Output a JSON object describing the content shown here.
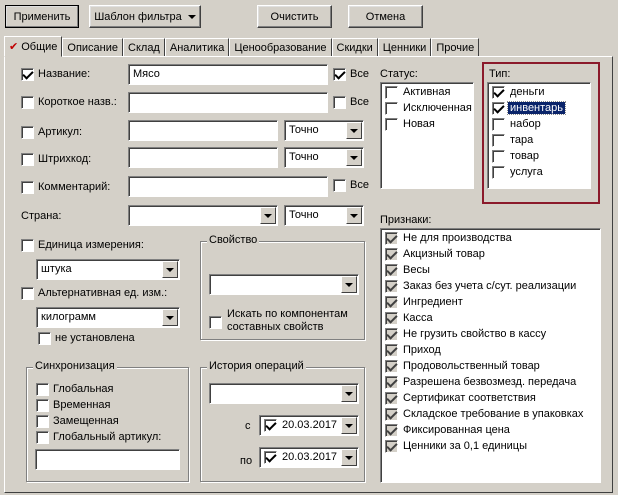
{
  "toolbar": {
    "apply": "Применить",
    "filter_template": "Шаблон фильтра",
    "clear": "Очистить",
    "cancel": "Отмена"
  },
  "tabs": [
    {
      "label": "Общие",
      "active": true
    },
    {
      "label": "Описание"
    },
    {
      "label": "Склад"
    },
    {
      "label": "Аналитика"
    },
    {
      "label": "Ценообразование"
    },
    {
      "label": "Скидки"
    },
    {
      "label": "Ценники"
    },
    {
      "label": "Прочие"
    }
  ],
  "fields": {
    "name": {
      "label": "Название:",
      "checked": true,
      "value": "Мясо",
      "all_label": "Все",
      "all_checked": true
    },
    "short_name": {
      "label": "Короткое назв.:",
      "checked": false,
      "value": "",
      "all_label": "Все",
      "all_checked": false
    },
    "article": {
      "label": "Артикул:",
      "checked": false,
      "value": "",
      "match": "Точно"
    },
    "barcode": {
      "label": "Штрихкод:",
      "checked": false,
      "value": "",
      "match": "Точно"
    },
    "comment": {
      "label": "Комментарий:",
      "checked": false,
      "value": "",
      "all_label": "Все",
      "all_checked": false
    },
    "country": {
      "label": "Страна:",
      "value": "",
      "match": "Точно"
    }
  },
  "unit": {
    "label": "Единица измерения:",
    "checked": false,
    "value": "штука",
    "alt_label": "Альтернативная ед. изм.:",
    "alt_checked": false,
    "alt_value": "килограмм",
    "not_set_label": "не установлена",
    "not_set_checked": false
  },
  "property": {
    "title": "Свойство",
    "value": "",
    "search_components": "Искать по компонентам составных свойств",
    "search_components_line1": "Искать по компонентам",
    "search_components_line2": "составных свойств"
  },
  "sync": {
    "title": "Синхронизация",
    "items": [
      {
        "label": "Глобальная",
        "checked": false
      },
      {
        "label": "Временная",
        "checked": false
      },
      {
        "label": "Замещенная",
        "checked": false
      },
      {
        "label": "Глобальный артикул:",
        "checked": false
      }
    ],
    "global_article_value": ""
  },
  "history": {
    "title": "История операций",
    "value": "",
    "from_label": "с",
    "from_date": "20.03.2017",
    "to_label": "по",
    "to_date": "20.03.2017"
  },
  "status": {
    "label": "Статус:",
    "items": [
      {
        "label": "Активная",
        "checked": false
      },
      {
        "label": "Исключенная",
        "checked": false
      },
      {
        "label": "Новая",
        "checked": false
      }
    ]
  },
  "type": {
    "label": "Тип:",
    "items": [
      {
        "label": "деньги",
        "checked": true
      },
      {
        "label": "инвентарь",
        "checked": true,
        "selected": true
      },
      {
        "label": "набор",
        "checked": false
      },
      {
        "label": "тара",
        "checked": false
      },
      {
        "label": "товар",
        "checked": false
      },
      {
        "label": "услуга",
        "checked": false
      }
    ],
    "highlight_color": "#8b1a2b"
  },
  "features": {
    "label": "Признаки:",
    "items": [
      {
        "label": "Не для производства",
        "checked": true
      },
      {
        "label": "Акцизный товар",
        "checked": true
      },
      {
        "label": "Весы",
        "checked": true
      },
      {
        "label": "Заказ без учета с/сут. реализации",
        "checked": true
      },
      {
        "label": "Ингредиент",
        "checked": true
      },
      {
        "label": "Касса",
        "checked": true
      },
      {
        "label": "Не грузить свойство в кассу",
        "checked": true
      },
      {
        "label": "Приход",
        "checked": true
      },
      {
        "label": "Продовольственный товар",
        "checked": true
      },
      {
        "label": "Разрешена безвозмезд. передача",
        "checked": true
      },
      {
        "label": "Сертификат соответствия",
        "checked": true
      },
      {
        "label": "Складское требование в упаковках",
        "checked": true
      },
      {
        "label": "Фиксированная цена",
        "checked": true
      },
      {
        "label": "Ценники за 0,1 единицы",
        "checked": true
      }
    ]
  }
}
